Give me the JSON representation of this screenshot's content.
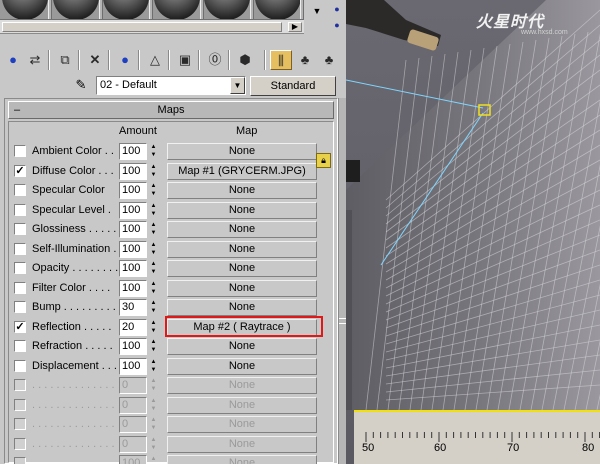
{
  "material": {
    "name": "02 - Default",
    "type": "Standard"
  },
  "maps_rollout": {
    "collapse_glyph": "–",
    "title": "Maps",
    "col_amount": "Amount",
    "col_map": "Map",
    "rows": [
      {
        "checked": false,
        "label": "Ambient Color . .",
        "amount": "100",
        "map": "None",
        "disabled": true
      },
      {
        "checked": true,
        "label": "Diffuse Color . . .",
        "amount": "100",
        "map": "Map #1 (GRYCERM.JPG)",
        "disabled": false
      },
      {
        "checked": false,
        "label": "Specular Color",
        "amount": "100",
        "map": "None",
        "disabled": false
      },
      {
        "checked": false,
        "label": "Specular Level .",
        "amount": "100",
        "map": "None",
        "disabled": false
      },
      {
        "checked": false,
        "label": "Glossiness . . . . .",
        "amount": "100",
        "map": "None",
        "disabled": false
      },
      {
        "checked": false,
        "label": "Self-Illumination .",
        "amount": "100",
        "map": "None",
        "disabled": false
      },
      {
        "checked": false,
        "label": "Opacity . . . . . . . .",
        "amount": "100",
        "map": "None",
        "disabled": false
      },
      {
        "checked": false,
        "label": "Filter Color . . . .",
        "amount": "100",
        "map": "None",
        "disabled": false
      },
      {
        "checked": false,
        "label": "Bump . . . . . . . . . .",
        "amount": "30",
        "map": "None",
        "disabled": false
      },
      {
        "checked": true,
        "label": "Reflection . . . . .",
        "amount": "20",
        "map": "Map #2 ( Raytrace )",
        "disabled": false,
        "highlighted": true
      },
      {
        "checked": false,
        "label": "Refraction . . . . .",
        "amount": "100",
        "map": "None",
        "disabled": false
      },
      {
        "checked": false,
        "label": "Displacement . . .",
        "amount": "100",
        "map": "None",
        "disabled": false
      },
      {
        "checked": false,
        "label": ". . . . . . . . . . . . . .",
        "amount": "0",
        "map": "None",
        "disabled": true
      },
      {
        "checked": false,
        "label": ". . . . . . . . . . . . . .",
        "amount": "0",
        "map": "None",
        "disabled": true
      },
      {
        "checked": false,
        "label": ". . . . . . . . . . . . . .",
        "amount": "0",
        "map": "None",
        "disabled": true
      },
      {
        "checked": false,
        "label": ". . . . . . . . . . . . . .",
        "amount": "0",
        "map": "None",
        "disabled": true
      },
      {
        "checked": false,
        "label": ". . . . . . . . . . . . . .",
        "amount": "100",
        "map": "None",
        "disabled": true
      }
    ]
  },
  "viewport": {
    "watermark": "火星时代",
    "watermark_sub": "www.hxsd.com",
    "ruler_ticks": [
      "50",
      "60",
      "70",
      "80"
    ],
    "highlight_color": "#e01818",
    "ruler_line_color": "#f2e00c"
  },
  "toolbar_icons": [
    "get-material-icon",
    "put-to-scene-icon",
    "assign-material-icon",
    "reset-icon",
    "copy-material-icon",
    "make-unique-icon",
    "put-to-library-icon",
    "material-effects-channel-icon",
    "show-map-in-viewport-icon",
    "show-end-result-icon",
    "go-to-parent-icon",
    "go-forward-icon"
  ]
}
